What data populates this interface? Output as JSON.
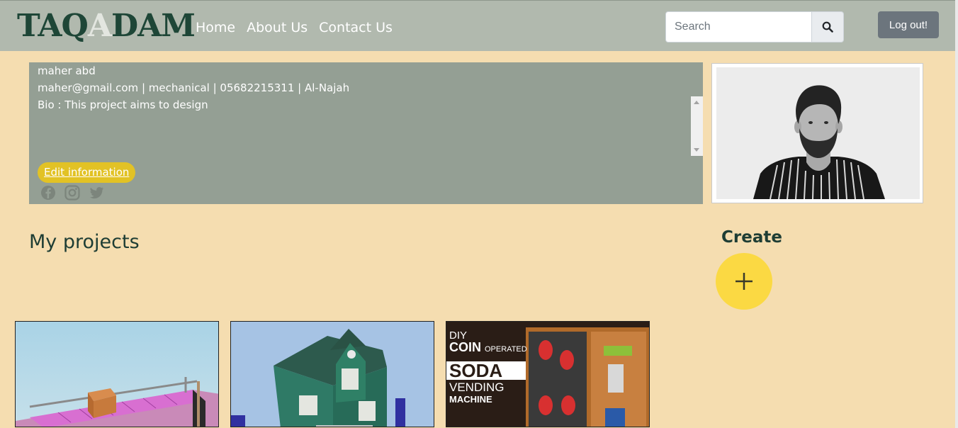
{
  "nav": {
    "logo_part1": "TAQ",
    "logo_part2": "A",
    "logo_part3": "DAM",
    "links": [
      "Home",
      "About Us",
      "Contact Us"
    ],
    "search_placeholder": "Search",
    "logout_label": "Log out!"
  },
  "profile": {
    "name": "maher abd",
    "contact": "maher@gmail.com | mechanical | 05682215311 | Al-Najah",
    "bio": "Bio : This project aims to design",
    "edit_label": "Edit information",
    "social_icons": [
      "facebook-icon",
      "instagram-icon",
      "twitter-icon"
    ]
  },
  "projects": {
    "title": "My projects",
    "create_label": "Create",
    "cards": [
      {
        "icon": "conveyor-image"
      },
      {
        "icon": "house-model-image"
      },
      {
        "icon": "vending-machine-image",
        "lines": [
          "DIY",
          "COIN",
          "OPERATED",
          "SODA",
          "VENDING",
          "MACHINE"
        ]
      }
    ]
  },
  "colors": {
    "navbar": "#b1b9ae",
    "logo": "#1e4637",
    "background": "#f5ddb0",
    "profile_box": "#949f94",
    "accent_yellow": "#fbd943",
    "heading": "#1e3d34"
  }
}
